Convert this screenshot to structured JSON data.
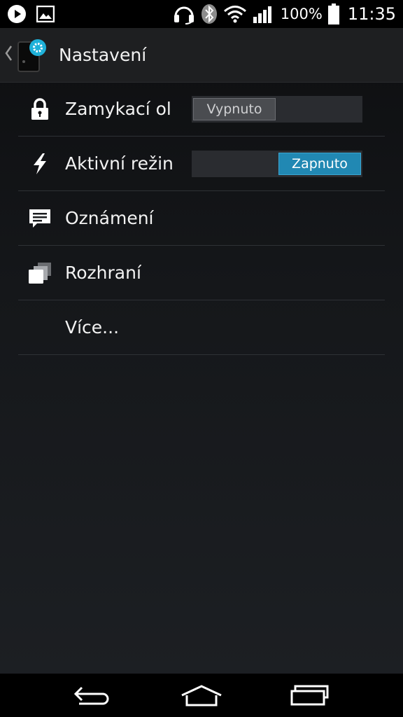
{
  "status_bar": {
    "battery_percent": "100%",
    "time": "11:35",
    "icons": [
      "play-icon",
      "image-icon",
      "headset-icon",
      "bluetooth-icon",
      "wifi-icon",
      "signal-icon",
      "battery-icon"
    ]
  },
  "action_bar": {
    "title": "Nastavení",
    "icons": [
      "back-caret-icon",
      "settings-app-icon"
    ]
  },
  "settings": {
    "items": [
      {
        "label": "Zamykací ol",
        "icon": "lock-icon",
        "toggle": {
          "state": "off",
          "label": "Vypnuto"
        }
      },
      {
        "label": "Aktivní režin",
        "icon": "lightning-icon",
        "toggle": {
          "state": "on",
          "label": "Zapnuto"
        }
      },
      {
        "label": "Oznámení",
        "icon": "notification-icon"
      },
      {
        "label": "Rozhraní",
        "icon": "windows-icon"
      },
      {
        "label": "Více..."
      }
    ]
  },
  "nav_bar": {
    "icons": [
      "back-icon",
      "home-icon",
      "recent-apps-icon"
    ]
  },
  "colors": {
    "accent": "#2188b3",
    "action_bar": "#1e1f21",
    "background": "#15171a",
    "divider": "#2e3135"
  }
}
